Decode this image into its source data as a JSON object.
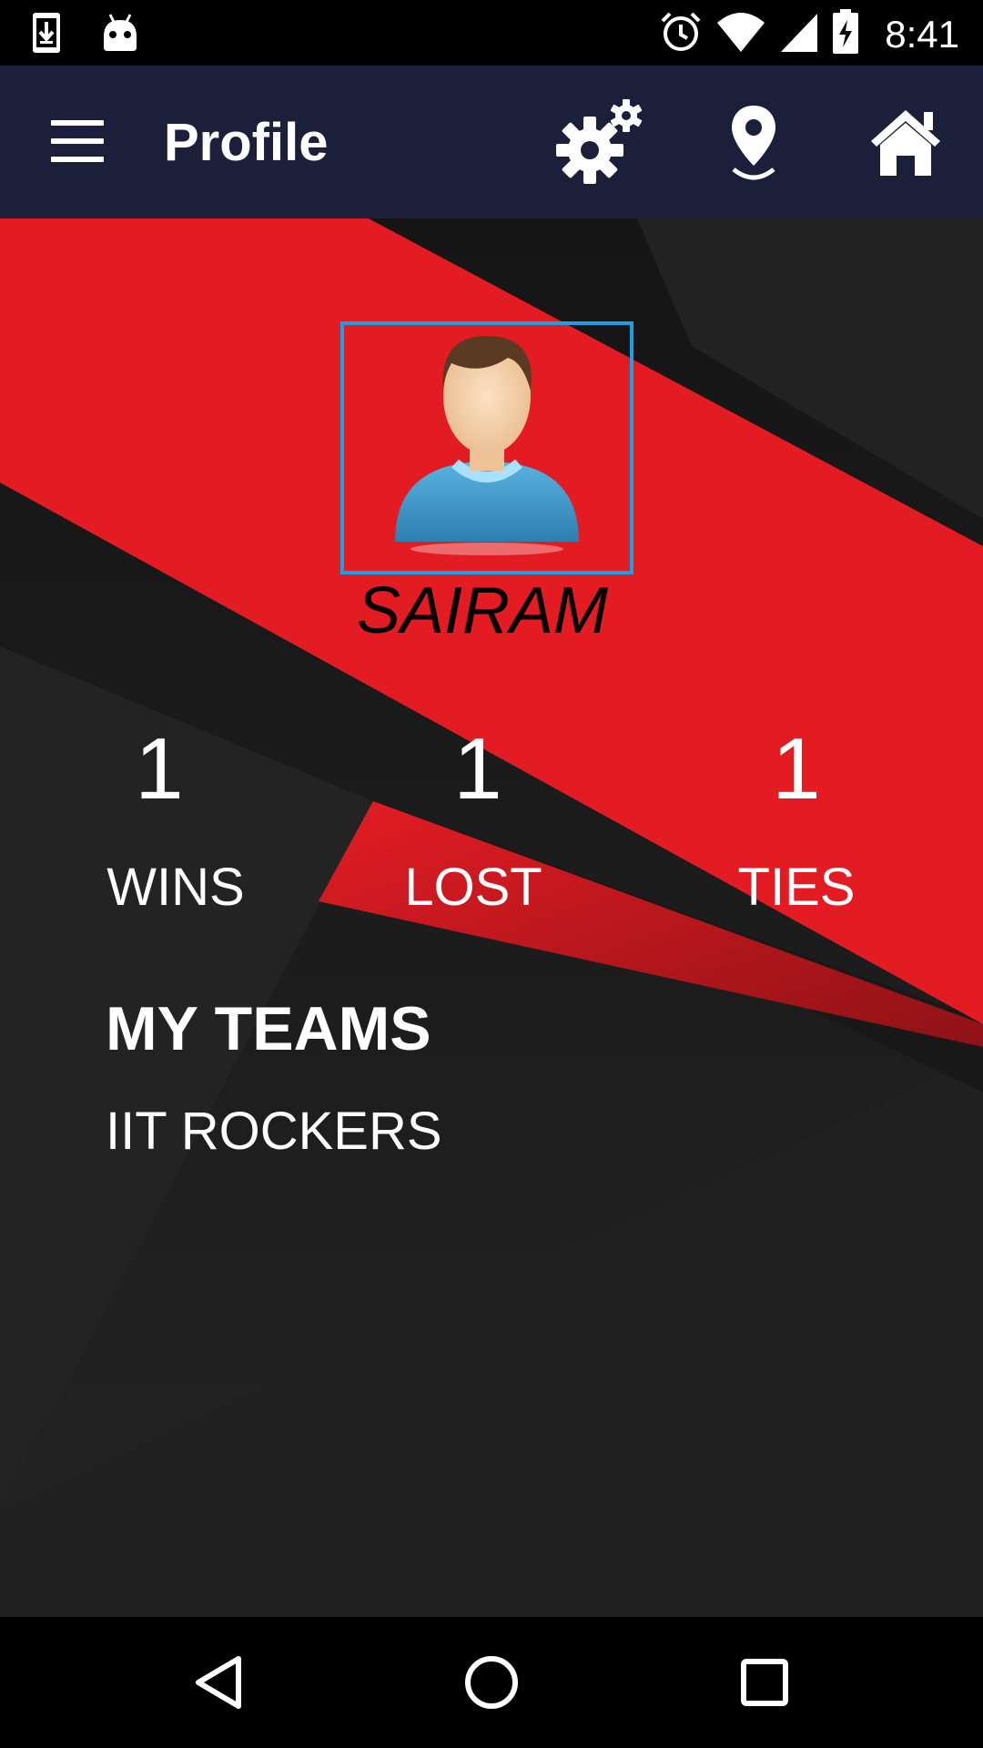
{
  "status_bar": {
    "time": "8:41",
    "icons": [
      "download-icon",
      "android-icon",
      "alarm-icon",
      "wifi-icon",
      "signal-icon",
      "battery-charging-icon"
    ]
  },
  "app_bar": {
    "title": "Profile",
    "icons": [
      "menu-icon",
      "settings-icon",
      "location-pin-icon",
      "home-icon"
    ]
  },
  "profile": {
    "name": "SAIRAM",
    "avatar_icon": "user-avatar-icon"
  },
  "stats": [
    {
      "value": "1",
      "label": "WINS"
    },
    {
      "value": "1",
      "label": "LOST"
    },
    {
      "value": "1",
      "label": "TIES"
    }
  ],
  "teams": {
    "title": "MY TEAMS",
    "items": [
      "IIT ROCKERS"
    ]
  },
  "colors": {
    "app_bar": "#1b1f3a",
    "accent_red": "#e31b23",
    "background_dark": "#1c1c1c",
    "avatar_border": "#1aa0e6"
  },
  "nav_bar": {
    "icons": [
      "back-icon",
      "home-circle-icon",
      "recents-icon"
    ]
  }
}
